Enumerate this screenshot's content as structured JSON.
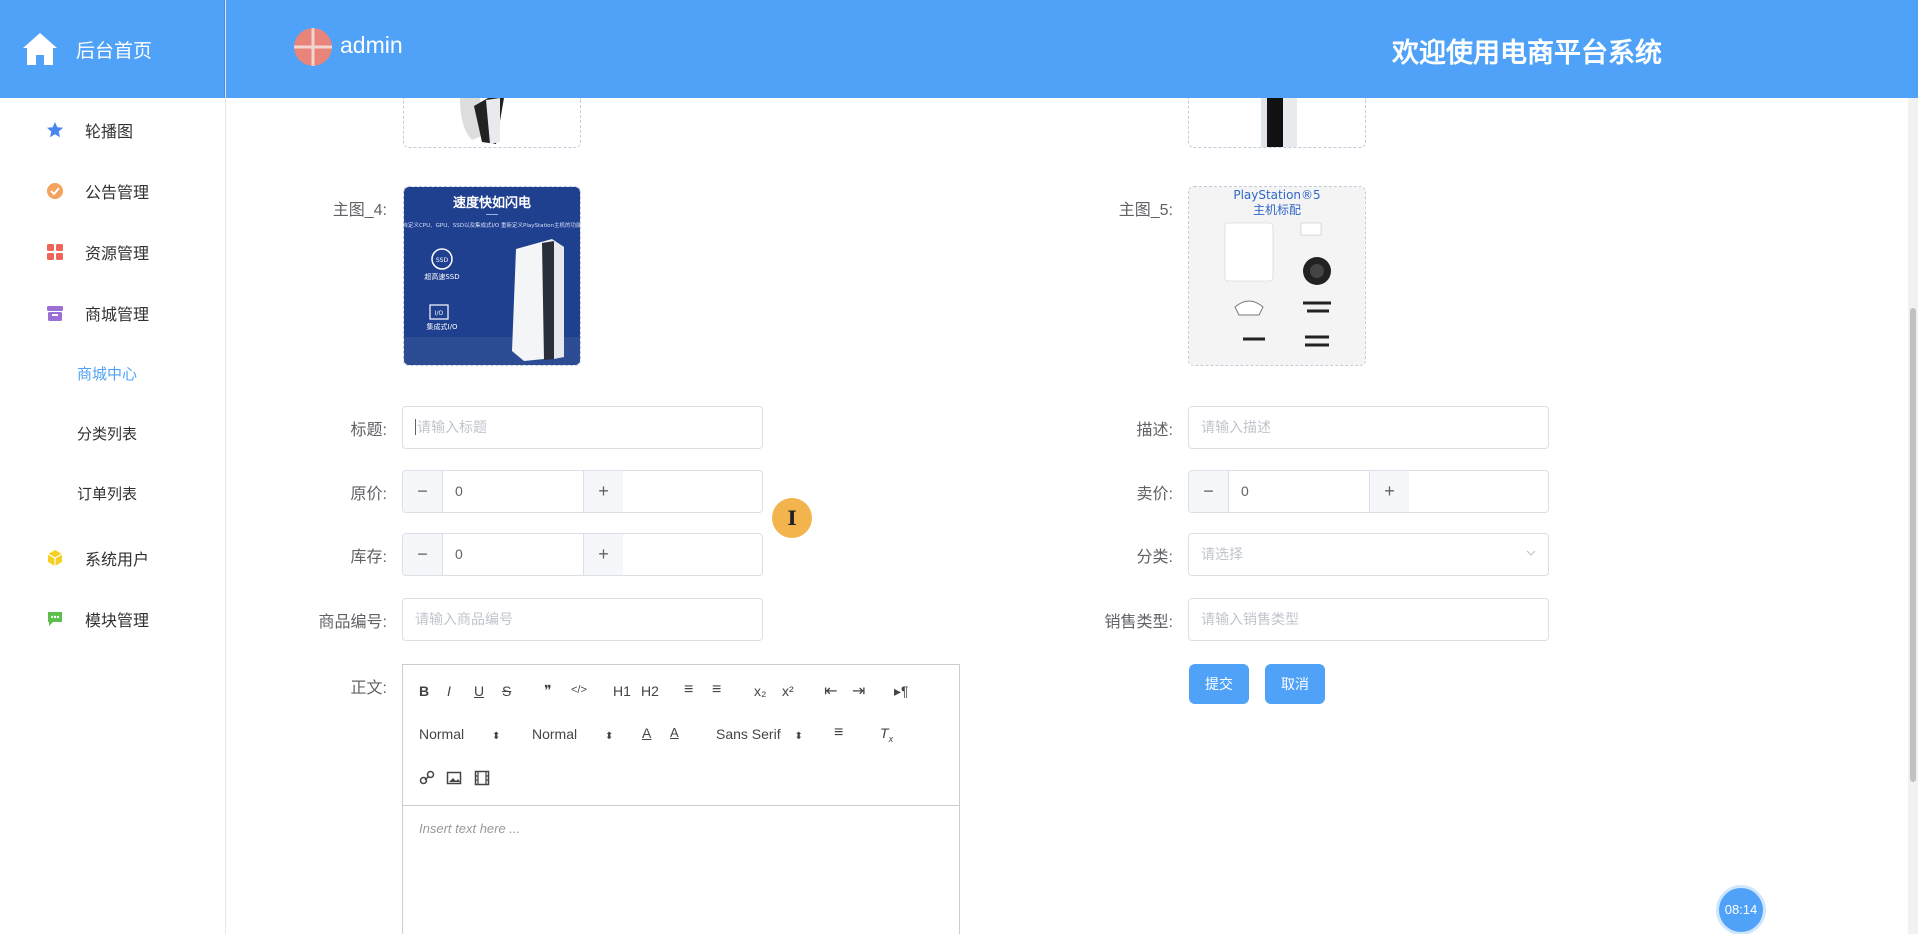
{
  "sidebar": {
    "home_label": "后台首页",
    "items": [
      {
        "label": "轮播图",
        "icon": "star-icon",
        "color": "#4a84f0"
      },
      {
        "label": "公告管理",
        "icon": "badge-icon",
        "color": "#f5a25d"
      },
      {
        "label": "资源管理",
        "icon": "grid-icon",
        "color": "#f0645a"
      },
      {
        "label": "商城管理",
        "icon": "archive-icon",
        "color": "#9b6fd6"
      }
    ],
    "submenu": [
      {
        "label": "商城中心",
        "active": true
      },
      {
        "label": "分类列表",
        "active": false
      },
      {
        "label": "订单列表",
        "active": false
      }
    ],
    "items_after": [
      {
        "label": "系统用户",
        "icon": "cube-icon",
        "color": "#f5d020"
      },
      {
        "label": "模块管理",
        "icon": "chat-icon",
        "color": "#5cbf4a"
      }
    ]
  },
  "header": {
    "username": "admin",
    "welcome": "欢迎使用电商平台系统"
  },
  "form": {
    "main_image_4_label": "主图_4:",
    "main_image_5_label": "主图_5:",
    "image4": {
      "title": "速度快如闪电",
      "sub": "凭借自定义CPU、GPU、SSD以及集成式I/O 重新定义PlayStation主机的功能界限",
      "ssd": "超高速SSD",
      "io": "集成式I/O"
    },
    "image5": {
      "title": "PlayStation®5",
      "sub": "主机标配"
    },
    "title_label": "标题:",
    "title_placeholder": "请输入标题",
    "desc_label": "描述:",
    "desc_placeholder": "请输入描述",
    "price_label": "原价:",
    "price_value": "0",
    "sale_label": "卖价:",
    "sale_value": "0",
    "stock_label": "库存:",
    "stock_value": "0",
    "category_label": "分类:",
    "category_placeholder": "请选择",
    "code_label": "商品编号:",
    "code_placeholder": "请输入商品编号",
    "sale_type_label": "销售类型:",
    "sale_type_placeholder": "请输入销售类型",
    "body_label": "正文:",
    "submit_label": "提交",
    "cancel_label": "取消",
    "minus": "−",
    "plus": "+"
  },
  "editor": {
    "bold": "B",
    "italic": "I",
    "underline": "U",
    "strike": "S",
    "quote": "❞",
    "code": "</>",
    "h1": "H1",
    "h2": "H2",
    "ol": "≡",
    "ul": "≡",
    "sub": "x₂",
    "sup": "x²",
    "outdent": "⇤",
    "indent": "⇥",
    "direction": "▸¶",
    "size_value": "Normal",
    "header_value": "Normal",
    "font_value": "Sans Serif",
    "placeholder": "Insert text here ..."
  },
  "clock": "08:14"
}
